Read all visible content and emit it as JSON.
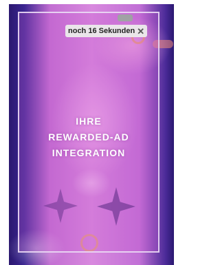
{
  "ad_timer": {
    "label": "noch 16 Sekunden",
    "close_icon": "✕"
  },
  "ad_placeholder": {
    "lines": [
      "IHRE",
      "REWARDED-AD",
      "INTEGRATION"
    ]
  },
  "colors": {
    "overlay_tint": "#c85ad2",
    "frame_border": "#ebdcf5",
    "timer_bg": "#ebebeb",
    "text": "#ffffff"
  }
}
